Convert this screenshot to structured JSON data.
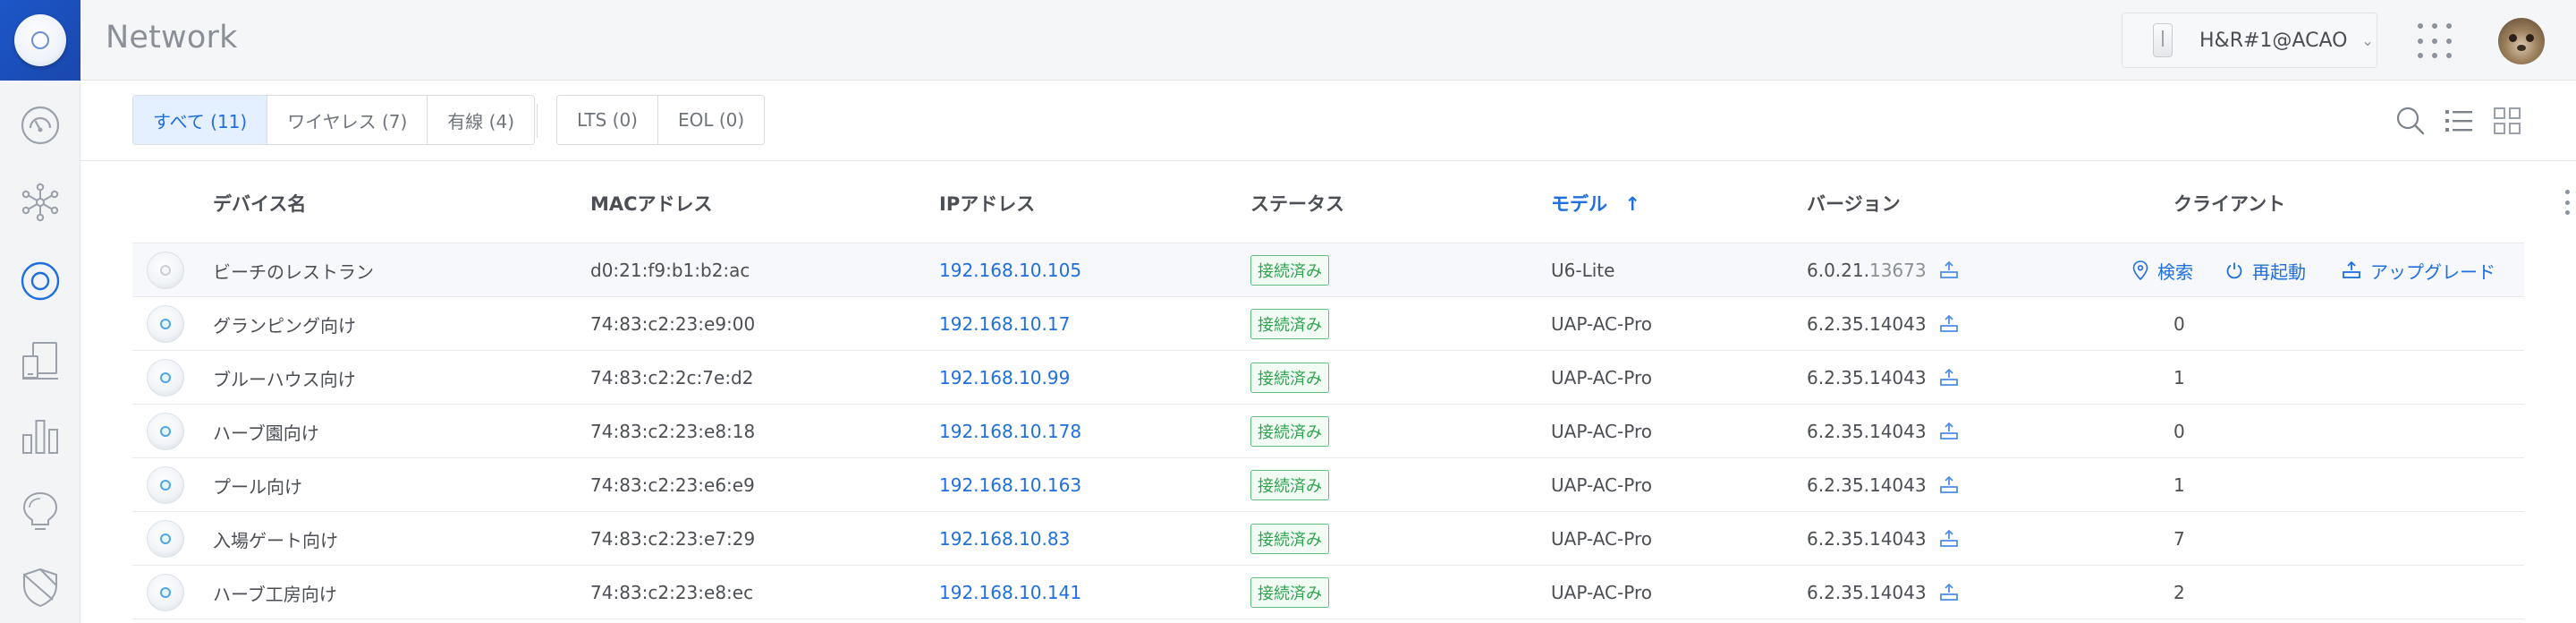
{
  "app": {
    "title": "Network"
  },
  "header": {
    "site_name": "H&R#1@ACAO"
  },
  "sidebar": {
    "items": [
      {
        "name": "dashboard",
        "icon": "dashboard-gauge-icon"
      },
      {
        "name": "topology",
        "icon": "topology-icon"
      },
      {
        "name": "devices",
        "icon": "access-point-icon",
        "active": true
      },
      {
        "name": "clients",
        "icon": "clients-devices-icon"
      },
      {
        "name": "statistics",
        "icon": "bar-chart-icon"
      },
      {
        "name": "insights",
        "icon": "lightbulb-icon"
      },
      {
        "name": "security",
        "icon": "shield-icon"
      }
    ]
  },
  "filters": {
    "type_tabs": [
      "すべて (11)",
      "ワイヤレス (7)",
      "有線 (4)"
    ],
    "lifecycle_tabs": [
      "LTS (0)",
      "EOL (0)"
    ],
    "active_tab": 0
  },
  "table": {
    "columns": [
      "デバイス名",
      "MACアドレス",
      "IPアドレス",
      "ステータス",
      "モデル",
      "バージョン",
      "クライアント"
    ],
    "sort_column": "モデル",
    "sort_indicator": "↑",
    "hover_actions": [
      "検索",
      "再起動",
      "アップグレード"
    ],
    "rows": [
      {
        "name": "ビーチのレストラン",
        "mac": "d0:21:f9:b1:b2:ac",
        "ip": "192.168.10.105",
        "status": "接続済み",
        "model": "U6-Lite",
        "version_major": "6.0.21.",
        "version_minor": "13673",
        "clients": "",
        "hover": true
      },
      {
        "name": "グランピング向け",
        "mac": "74:83:c2:23:e9:00",
        "ip": "192.168.10.17",
        "status": "接続済み",
        "model": "UAP-AC-Pro",
        "version_major": "6.2.35.14043",
        "version_minor": "",
        "clients": "0"
      },
      {
        "name": "ブルーハウス向け",
        "mac": "74:83:c2:2c:7e:d2",
        "ip": "192.168.10.99",
        "status": "接続済み",
        "model": "UAP-AC-Pro",
        "version_major": "6.2.35.14043",
        "version_minor": "",
        "clients": "1"
      },
      {
        "name": "ハーブ園向け",
        "mac": "74:83:c2:23:e8:18",
        "ip": "192.168.10.178",
        "status": "接続済み",
        "model": "UAP-AC-Pro",
        "version_major": "6.2.35.14043",
        "version_minor": "",
        "clients": "0"
      },
      {
        "name": "プール向け",
        "mac": "74:83:c2:23:e6:e9",
        "ip": "192.168.10.163",
        "status": "接続済み",
        "model": "UAP-AC-Pro",
        "version_major": "6.2.35.14043",
        "version_minor": "",
        "clients": "1"
      },
      {
        "name": "入場ゲート向け",
        "mac": "74:83:c2:23:e7:29",
        "ip": "192.168.10.83",
        "status": "接続済み",
        "model": "UAP-AC-Pro",
        "version_major": "6.2.35.14043",
        "version_minor": "",
        "clients": "7"
      },
      {
        "name": "ハーブ工房向け",
        "mac": "74:83:c2:23:e8:ec",
        "ip": "192.168.10.141",
        "status": "接続済み",
        "model": "UAP-AC-Pro",
        "version_major": "6.2.35.14043",
        "version_minor": "",
        "clients": "2"
      }
    ]
  },
  "colors": {
    "accent": "#1f6fe0",
    "status_ok": "#2ea44f",
    "logo_bg": "#1c56c8"
  }
}
